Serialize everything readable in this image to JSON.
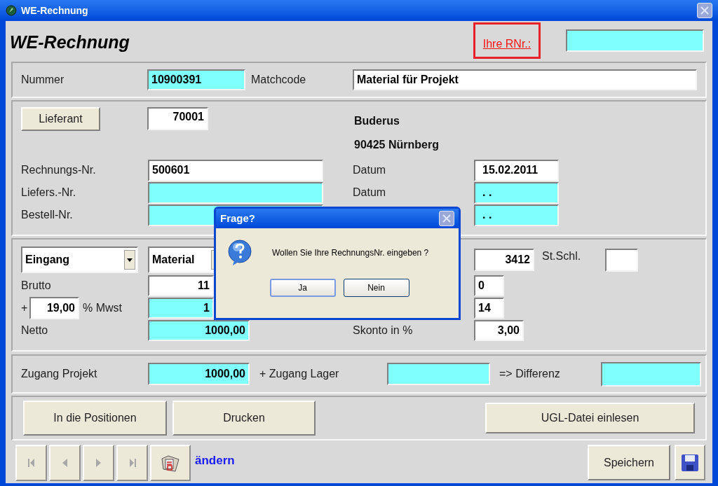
{
  "window": {
    "title": "WE-Rechnung"
  },
  "form_title": "WE-Rechnung",
  "rnr": {
    "label": "Ihre RNr.:",
    "highlighted": true
  },
  "nummer": {
    "label": "Nummer",
    "value": "10900391",
    "readonly": true
  },
  "matchcode": {
    "label": "Matchcode",
    "value": "Material für Projekt",
    "readonly": false
  },
  "lieferant": {
    "button": "Lieferant",
    "value": "70001",
    "name": "Buderus",
    "city": "90425 Nürnberg"
  },
  "rows": [
    {
      "label": "Rechnungs-Nr.",
      "value": "500601",
      "readonly": false,
      "date_label": "Datum",
      "date": "15.02.2011",
      "date_readonly": false
    },
    {
      "label": "Liefers.-Nr.",
      "readonly": true,
      "date_label": "Datum",
      "date": ". .",
      "date_readonly": true
    },
    {
      "label": "Bestell-Nr.",
      "readonly": true,
      "date": ". .",
      "date_readonly": true
    }
  ],
  "booking": {
    "type_select": "Eingang",
    "category_select": "Material",
    "account": "3412",
    "key_label": "St.Schl."
  },
  "amounts": [
    {
      "kind": "plain",
      "label": "Brutto",
      "value": "11",
      "readonly": false,
      "right_value": "0"
    },
    {
      "kind": "tax",
      "prefix": "+",
      "rate": "19,00",
      "label": "% Mwst",
      "value": "1",
      "readonly": true,
      "right_value": "14"
    },
    {
      "kind": "plain",
      "label": "Netto",
      "value": "1000,00",
      "readonly": true,
      "right_label": "Skonto in %",
      "right_value": "3,00"
    }
  ],
  "zugang": {
    "projekt_label": "Zugang Projekt",
    "projekt_value": "1000,00",
    "lager_label": "+ Zugang Lager",
    "differenz_label": "=> Differenz"
  },
  "actions": [
    "In die Positionen",
    "Drucken",
    "UGL-Datei einlesen"
  ],
  "mode": "ändern",
  "save_button": "Speichern",
  "dialog": {
    "title": "Frage?",
    "message": "Wollen Sie Ihre RechnungsNr. eingeben ?",
    "buttons": [
      {
        "label": "Ja",
        "focused": true
      },
      {
        "label": "Nein",
        "focused": false
      }
    ]
  }
}
